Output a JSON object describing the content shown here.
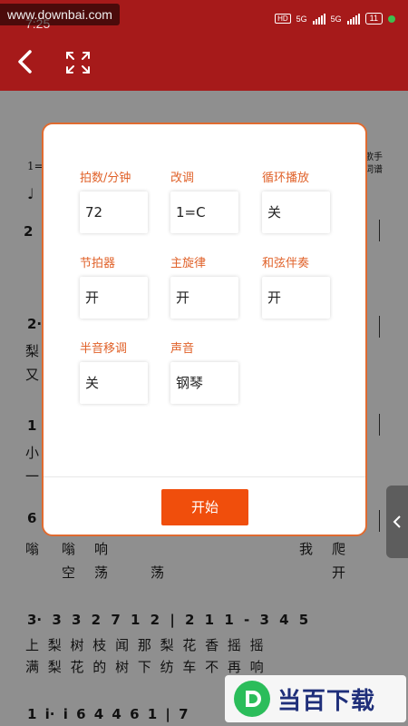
{
  "watermark": "www.downbai.com",
  "status_bar": {
    "time": "7:25",
    "hd": "HD",
    "network_1": "5G",
    "network_2": "5G",
    "battery": "11"
  },
  "header": {
    "back_icon": "chevron-left-icon",
    "expand_icon": "fullscreen-icon",
    "color": "#a61a1a"
  },
  "score": {
    "right_label_1": "歌手",
    "right_label_2": "词谱",
    "key_label": "1=",
    "row1_num": "2",
    "row2_num": "2·",
    "row2_lyric_a": "梨",
    "row2_lyric_b": "又",
    "row3_num": "1",
    "row3_lyric_a": "小",
    "row3_lyric_b": "一",
    "row4_num": "6",
    "row4_lyrics_a": [
      "嗡",
      "嗡",
      "响",
      "我",
      "爬"
    ],
    "row4_lyrics_b": [
      "空",
      "荡",
      "荡",
      "开"
    ],
    "row5_notes": "3· 3 3 2 7 1 2 | 2 1 1 - 3 4 5",
    "row5_lyrics_a": "上 梨 树 枝 闻 那 梨   花 香     摇 摇",
    "row5_lyrics_b": "满 梨 花 的 树 下 纺   车 不 再   响",
    "row6_notes": "1 i· i 6 4 4 6 1 | 7"
  },
  "dialog": {
    "fields": [
      {
        "label": "拍数/分钟",
        "value": "72"
      },
      {
        "label": "改调",
        "value": "1=C"
      },
      {
        "label": "循环播放",
        "value": "关"
      },
      {
        "label": "节拍器",
        "value": "开"
      },
      {
        "label": "主旋律",
        "value": "开"
      },
      {
        "label": "和弦伴奏",
        "value": "开"
      },
      {
        "label": "半音移调",
        "value": "关"
      },
      {
        "label": "声音",
        "value": "钢琴"
      }
    ],
    "start_label": "开始",
    "accent": "#f04e0c"
  },
  "side_tab_icon": "chevron-left-icon",
  "logo": {
    "text": "当百下载"
  }
}
